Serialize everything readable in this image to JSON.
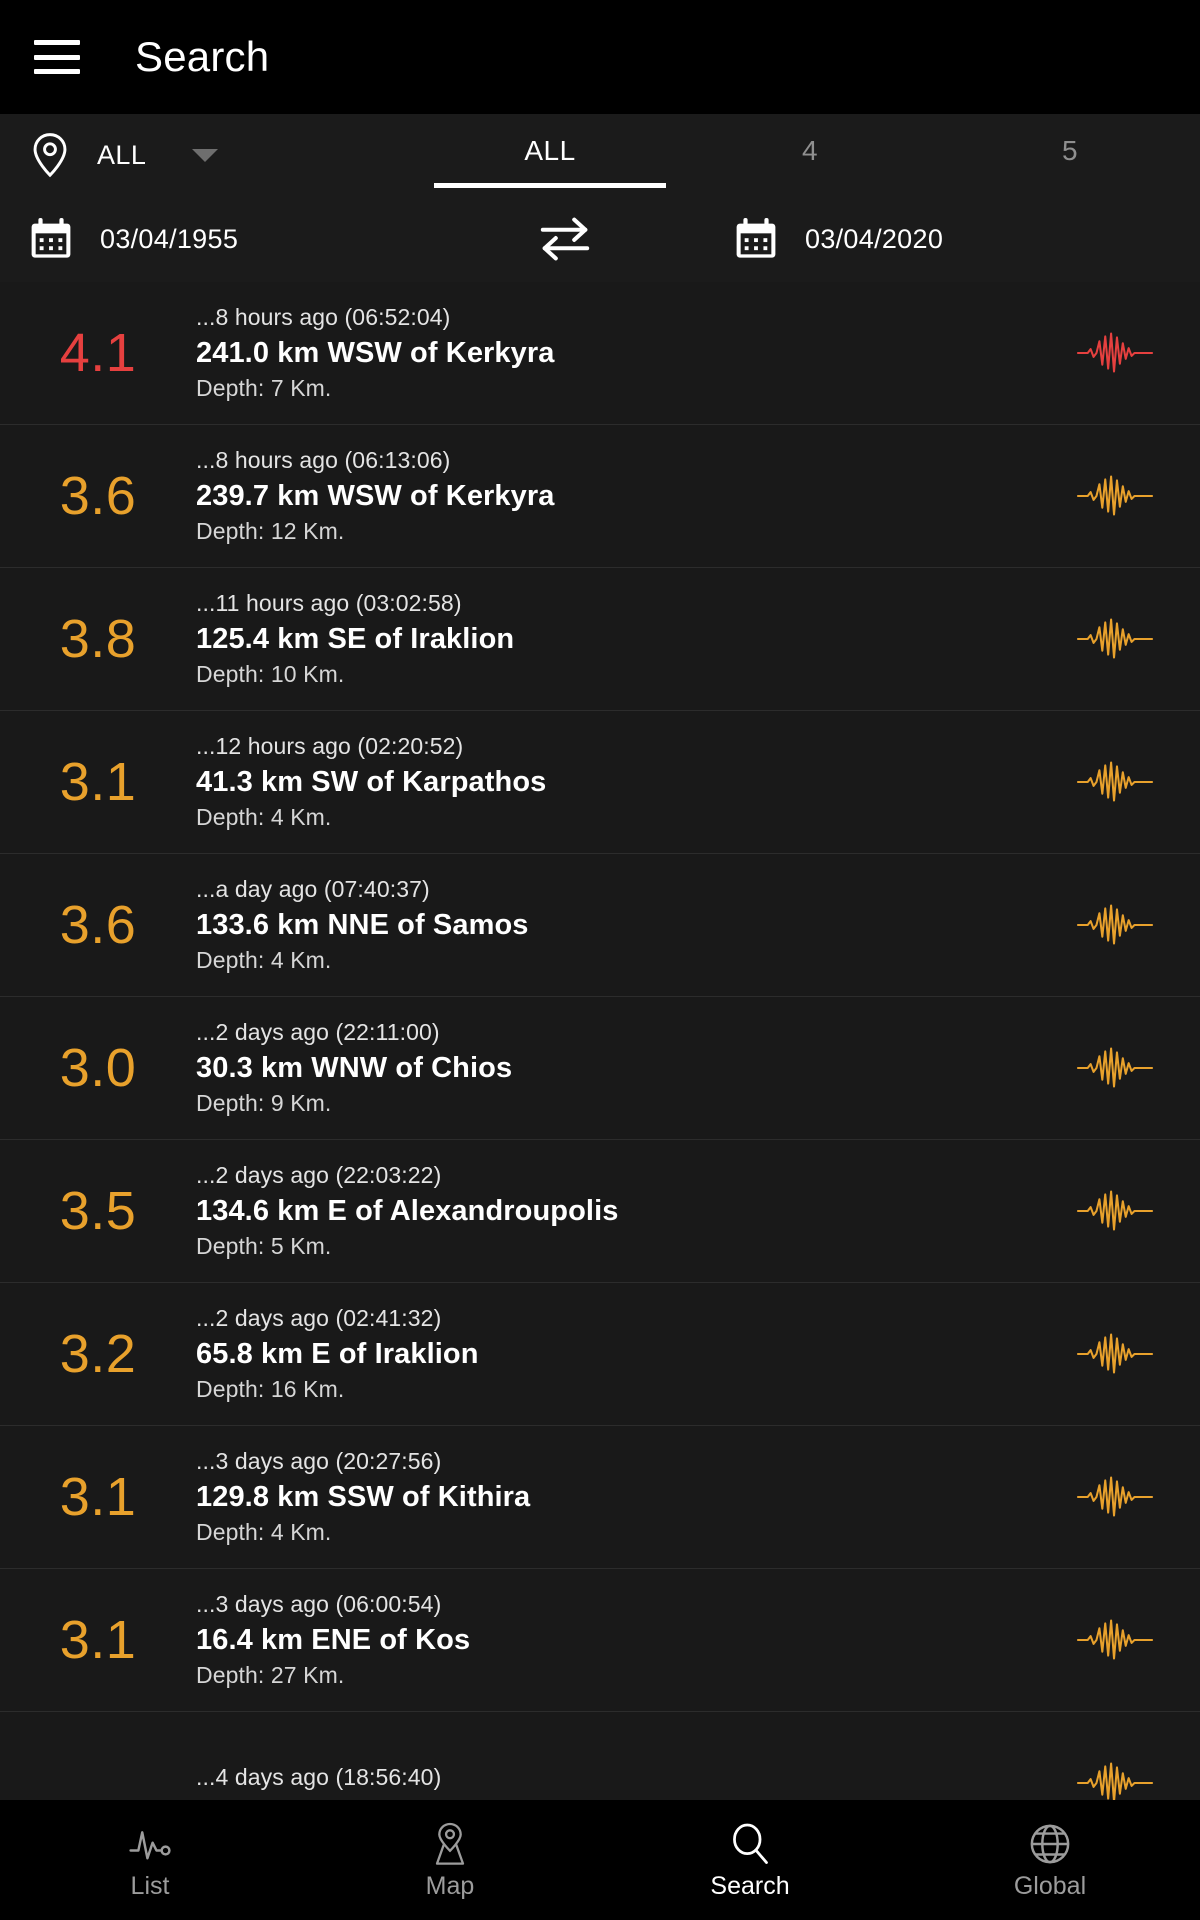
{
  "appbar": {
    "menu_icon": "hamburger-menu-icon",
    "title": "Search"
  },
  "filters": {
    "region": {
      "icon": "location-pin-icon",
      "value": "ALL",
      "caret_icon": "chevron-down-icon"
    },
    "magnitude_tabs": [
      {
        "label": "ALL",
        "active": true
      },
      {
        "label": "4",
        "active": false
      },
      {
        "label": "5",
        "active": false
      }
    ],
    "date_start": {
      "icon": "calendar-icon",
      "value": "03/04/1955"
    },
    "date_end": {
      "icon": "calendar-icon",
      "value": "03/04/2020"
    },
    "swap_icon": "swap-arrows-icon"
  },
  "colors": {
    "magnitude_red": "#e6403f",
    "magnitude_orange": "#e8a12c",
    "background": "#191919",
    "appbar": "#000000",
    "filter_bar": "#1b1b1b",
    "divider": "#2c2c2c",
    "text_primary": "#ffffff",
    "text_muted": "#8f8f8f"
  },
  "list": [
    {
      "magnitude": "4.1",
      "color": "#e6403f",
      "when": "...8 hours ago (06:52:04)",
      "place": "241.0 km WSW of Kerkyra",
      "depth": "Depth: 7 Km.",
      "icon": "seismograph-waveform-icon"
    },
    {
      "magnitude": "3.6",
      "color": "#e8a12c",
      "when": "...8 hours ago (06:13:06)",
      "place": "239.7 km WSW of Kerkyra",
      "depth": "Depth: 12 Km.",
      "icon": "seismograph-waveform-icon"
    },
    {
      "magnitude": "3.8",
      "color": "#e8a12c",
      "when": "...11 hours ago (03:02:58)",
      "place": "125.4 km SE of Iraklion",
      "depth": "Depth: 10 Km.",
      "icon": "seismograph-waveform-icon"
    },
    {
      "magnitude": "3.1",
      "color": "#e8a12c",
      "when": "...12 hours ago (02:20:52)",
      "place": "41.3 km SW of Karpathos",
      "depth": "Depth: 4 Km.",
      "icon": "seismograph-waveform-icon"
    },
    {
      "magnitude": "3.6",
      "color": "#e8a12c",
      "when": "...a day ago (07:40:37)",
      "place": "133.6 km NNE of Samos",
      "depth": "Depth: 4 Km.",
      "icon": "seismograph-waveform-icon"
    },
    {
      "magnitude": "3.0",
      "color": "#e8a12c",
      "when": "...2 days ago (22:11:00)",
      "place": "30.3 km WNW of Chios",
      "depth": "Depth: 9 Km.",
      "icon": "seismograph-waveform-icon"
    },
    {
      "magnitude": "3.5",
      "color": "#e8a12c",
      "when": "...2 days ago (22:03:22)",
      "place": "134.6 km E of Alexandroupolis",
      "depth": "Depth: 5 Km.",
      "icon": "seismograph-waveform-icon"
    },
    {
      "magnitude": "3.2",
      "color": "#e8a12c",
      "when": "...2 days ago (02:41:32)",
      "place": "65.8 km E of Iraklion",
      "depth": "Depth: 16 Km.",
      "icon": "seismograph-waveform-icon"
    },
    {
      "magnitude": "3.1",
      "color": "#e8a12c",
      "when": "...3 days ago (20:27:56)",
      "place": "129.8 km SSW of Kithira",
      "depth": "Depth: 4 Km.",
      "icon": "seismograph-waveform-icon"
    },
    {
      "magnitude": "3.1",
      "color": "#e8a12c",
      "when": "...3 days ago (06:00:54)",
      "place": "16.4 km ENE of Kos",
      "depth": "Depth: 27 Km.",
      "icon": "seismograph-waveform-icon"
    },
    {
      "magnitude": "",
      "color": "#e8a12c",
      "when": "...4 days ago (18:56:40)",
      "place": "",
      "depth": "",
      "icon": "seismograph-waveform-icon"
    }
  ],
  "bottomnav": [
    {
      "label": "List",
      "icon": "pulse-line-icon",
      "active": false
    },
    {
      "label": "Map",
      "icon": "map-pin-icon",
      "active": false
    },
    {
      "label": "Search",
      "icon": "search-icon",
      "active": true
    },
    {
      "label": "Global",
      "icon": "globe-icon",
      "active": false
    }
  ]
}
